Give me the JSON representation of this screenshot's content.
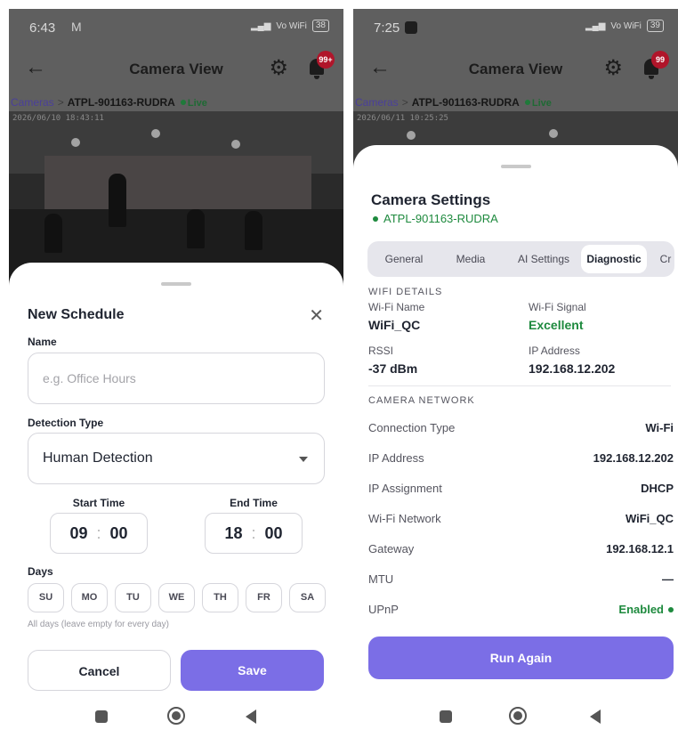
{
  "left": {
    "status": {
      "time": "6:43",
      "extra": "M",
      "battery": "38",
      "wifi_label": "Vo WiFi"
    },
    "header": {
      "title": "Camera View",
      "badge": "99+"
    },
    "breadcrumb": {
      "root": "Cameras",
      "separator": ">",
      "current": "ATPL-901163-RUDRA",
      "live": "Live"
    },
    "feed": {
      "timestamp": "2026/06/10 18:43:11"
    },
    "modal": {
      "title": "New Schedule",
      "close_label": "✕",
      "name_label": "Name",
      "name_placeholder": "e.g. Office Hours",
      "name_value": "",
      "detection_label": "Detection Type",
      "detection_value": "Human Detection",
      "start_label": "Start Time",
      "start_hour": "09",
      "start_minute": "00",
      "end_label": "End Time",
      "end_hour": "18",
      "end_minute": "00",
      "colon": ":",
      "days_label": "Days",
      "days": [
        "SU",
        "MO",
        "TU",
        "WE",
        "TH",
        "FR",
        "SA"
      ],
      "days_hint": "All days (leave empty for every day)",
      "cancel_label": "Cancel",
      "save_label": "Save"
    }
  },
  "right": {
    "status": {
      "time": "7:25",
      "battery": "39",
      "wifi_label": "Vo WiFi"
    },
    "header": {
      "title": "Camera View",
      "badge": "99"
    },
    "breadcrumb": {
      "root": "Cameras",
      "separator": ">",
      "current": "ATPL-901163-RUDRA",
      "live": "Live"
    },
    "feed": {
      "timestamp": "2026/06/11 10:25:25"
    },
    "settings": {
      "title": "Camera Settings",
      "camera_name": "ATPL-901163-RUDRA",
      "tabs": [
        {
          "label": "General",
          "active": false
        },
        {
          "label": "Media",
          "active": false
        },
        {
          "label": "AI Settings",
          "active": false
        },
        {
          "label": "Diagnostic",
          "active": true
        },
        {
          "label": "Cr",
          "active": false
        }
      ],
      "wifi_section": "WIFI DETAILS",
      "wifi_name_label": "Wi-Fi Name",
      "wifi_name": "WiFi_QC",
      "wifi_signal_label": "Wi-Fi Signal",
      "wifi_signal": "Excellent",
      "rssi_label": "RSSI",
      "rssi": "-37 dBm",
      "ip_label": "IP Address",
      "ip": "192.168.12.202",
      "network_section": "CAMERA NETWORK",
      "network_rows": [
        {
          "label": "Connection Type",
          "value": "Wi-Fi"
        },
        {
          "label": "IP Address",
          "value": "192.168.12.202"
        },
        {
          "label": "IP Assignment",
          "value": "DHCP"
        },
        {
          "label": "Wi-Fi Network",
          "value": "WiFi_QC"
        },
        {
          "label": "Gateway",
          "value": "192.168.12.1"
        },
        {
          "label": "MTU",
          "value": "—"
        },
        {
          "label": "UPnP",
          "value": "Enabled"
        }
      ],
      "run_again_label": "Run Again"
    }
  },
  "colors": {
    "accent": "#7b6ee6",
    "success": "#1e8a3e",
    "badge": "#b0152a"
  }
}
